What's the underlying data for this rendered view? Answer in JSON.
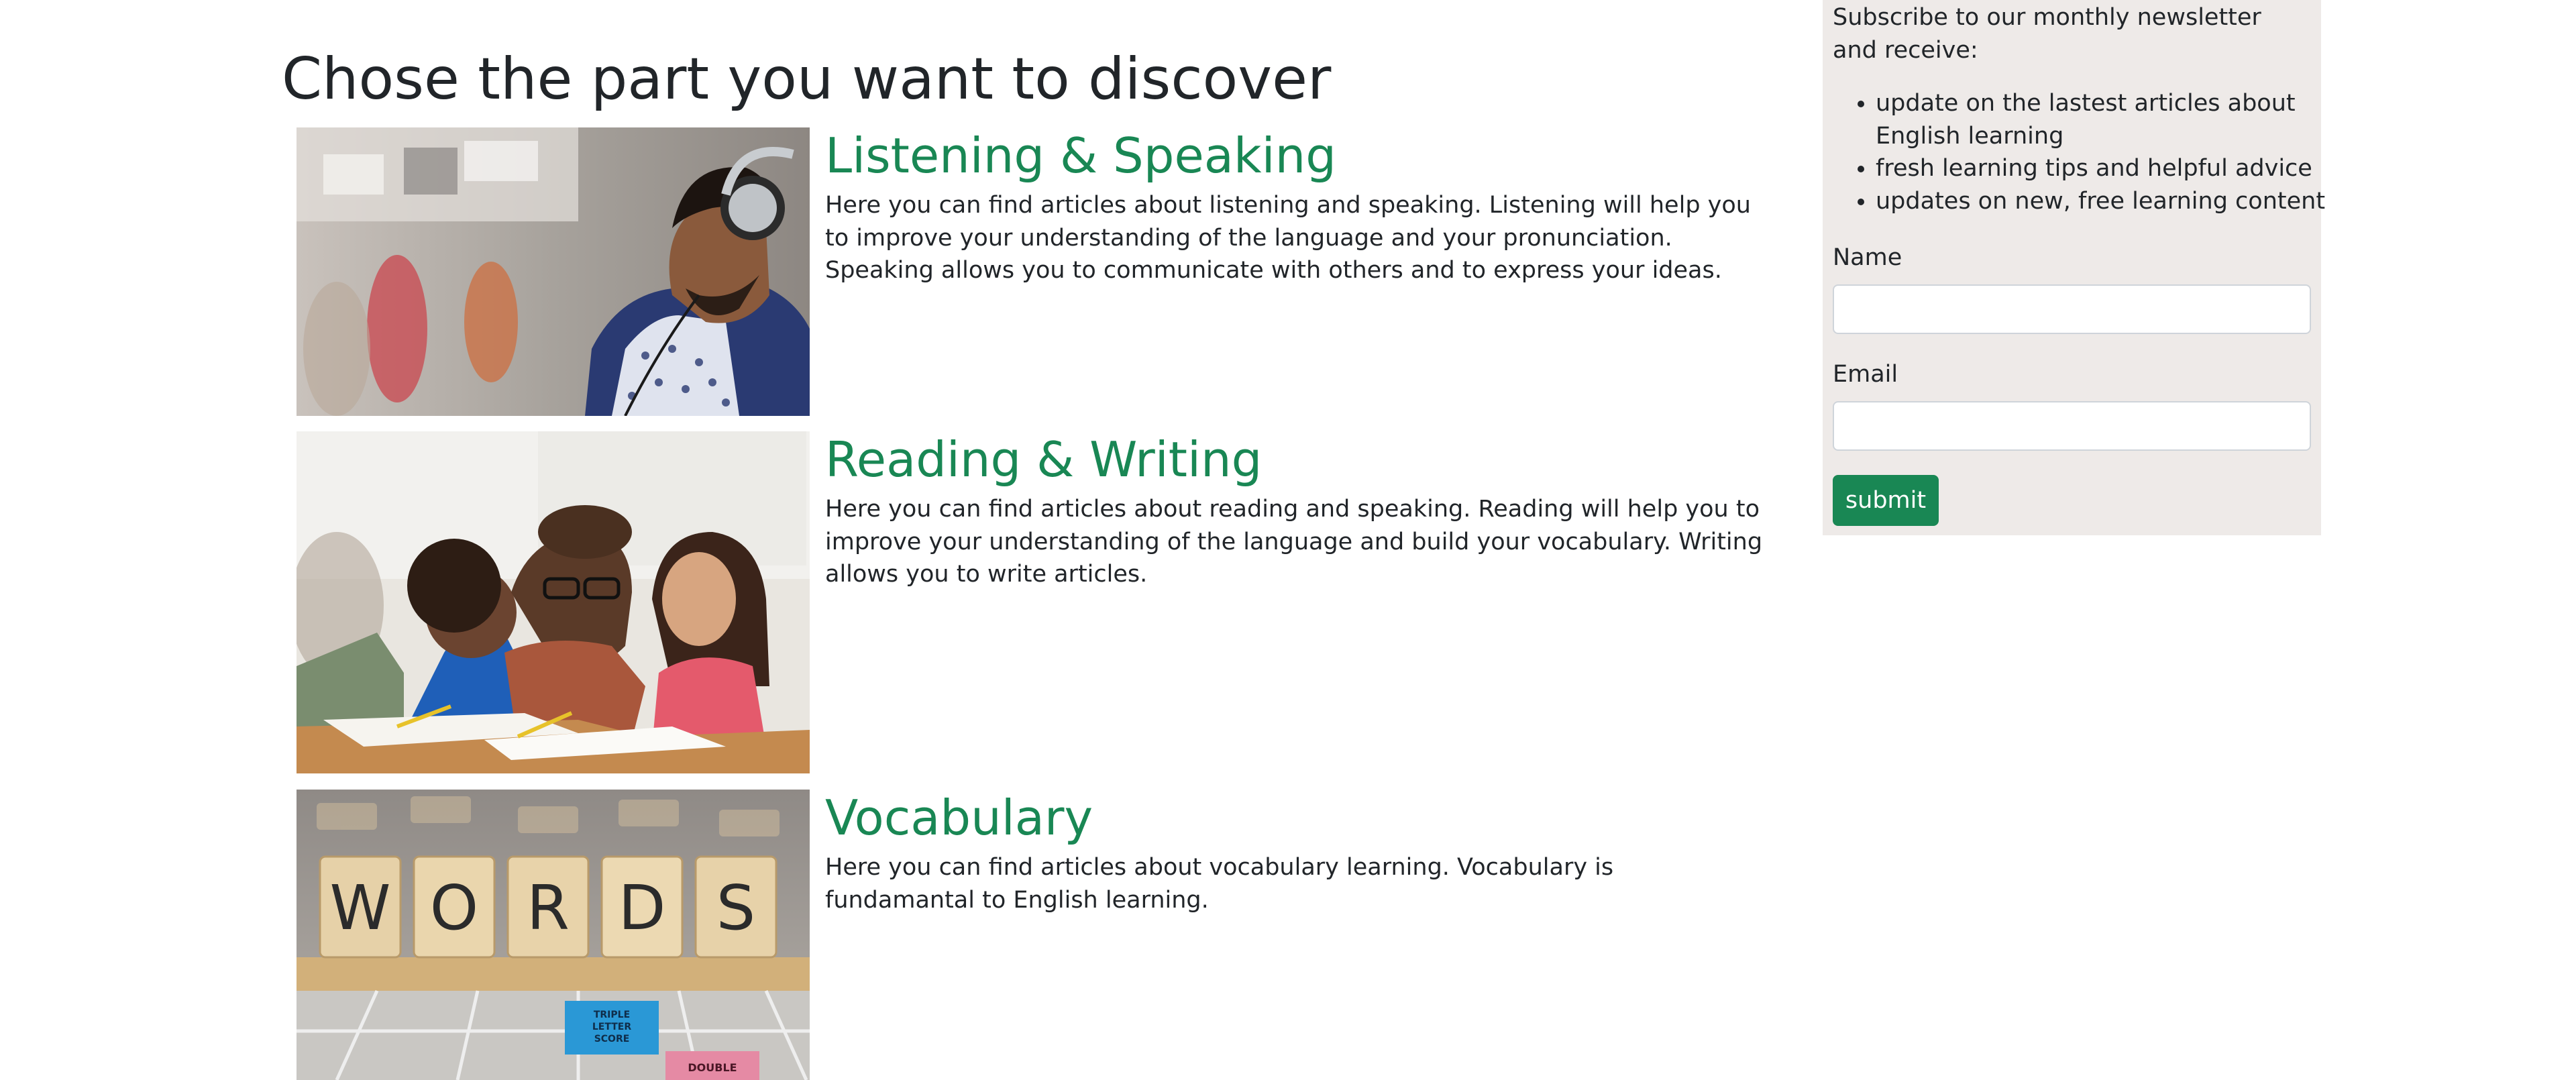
{
  "page": {
    "title": "Chose the part you want to discover"
  },
  "sections": [
    {
      "title": "Listening & Speaking",
      "text": "Here you can find articles about listening and speaking. Listening will help you to improve your understanding of the language and your pronunciation. Speaking allows you to communicate with others and to express your ideas."
    },
    {
      "title": "Reading & Writing",
      "text": "Here you can find articles about reading and speaking. Reading will help you to improve your understanding of the language and build your vocabulary. Writing allows you to write articles."
    },
    {
      "title": "Vocabulary",
      "text": "Here you can find articles about vocabulary learning. Vocabulary is fundamantal to English learning."
    }
  ],
  "images": {
    "tiles": [
      "W",
      "O",
      "R",
      "D",
      "S"
    ],
    "board_square_blue": [
      "TRIPLE",
      "LETTER",
      "SCORE"
    ],
    "board_square_pink": "DOUBLE"
  },
  "sidebar": {
    "intro": "Subscribe to our monthly newsletter and receive:",
    "benefits": [
      "update on the lastest articles about English learning",
      "fresh learning tips and helpful advice",
      "updates on new, free learning content"
    ],
    "name_label": "Name",
    "name_value": "",
    "email_label": "Email",
    "email_value": "",
    "submit_label": "submit"
  },
  "colors": {
    "accent": "#198754",
    "sidebar_bg": "#eeeae8",
    "text": "#212529"
  }
}
